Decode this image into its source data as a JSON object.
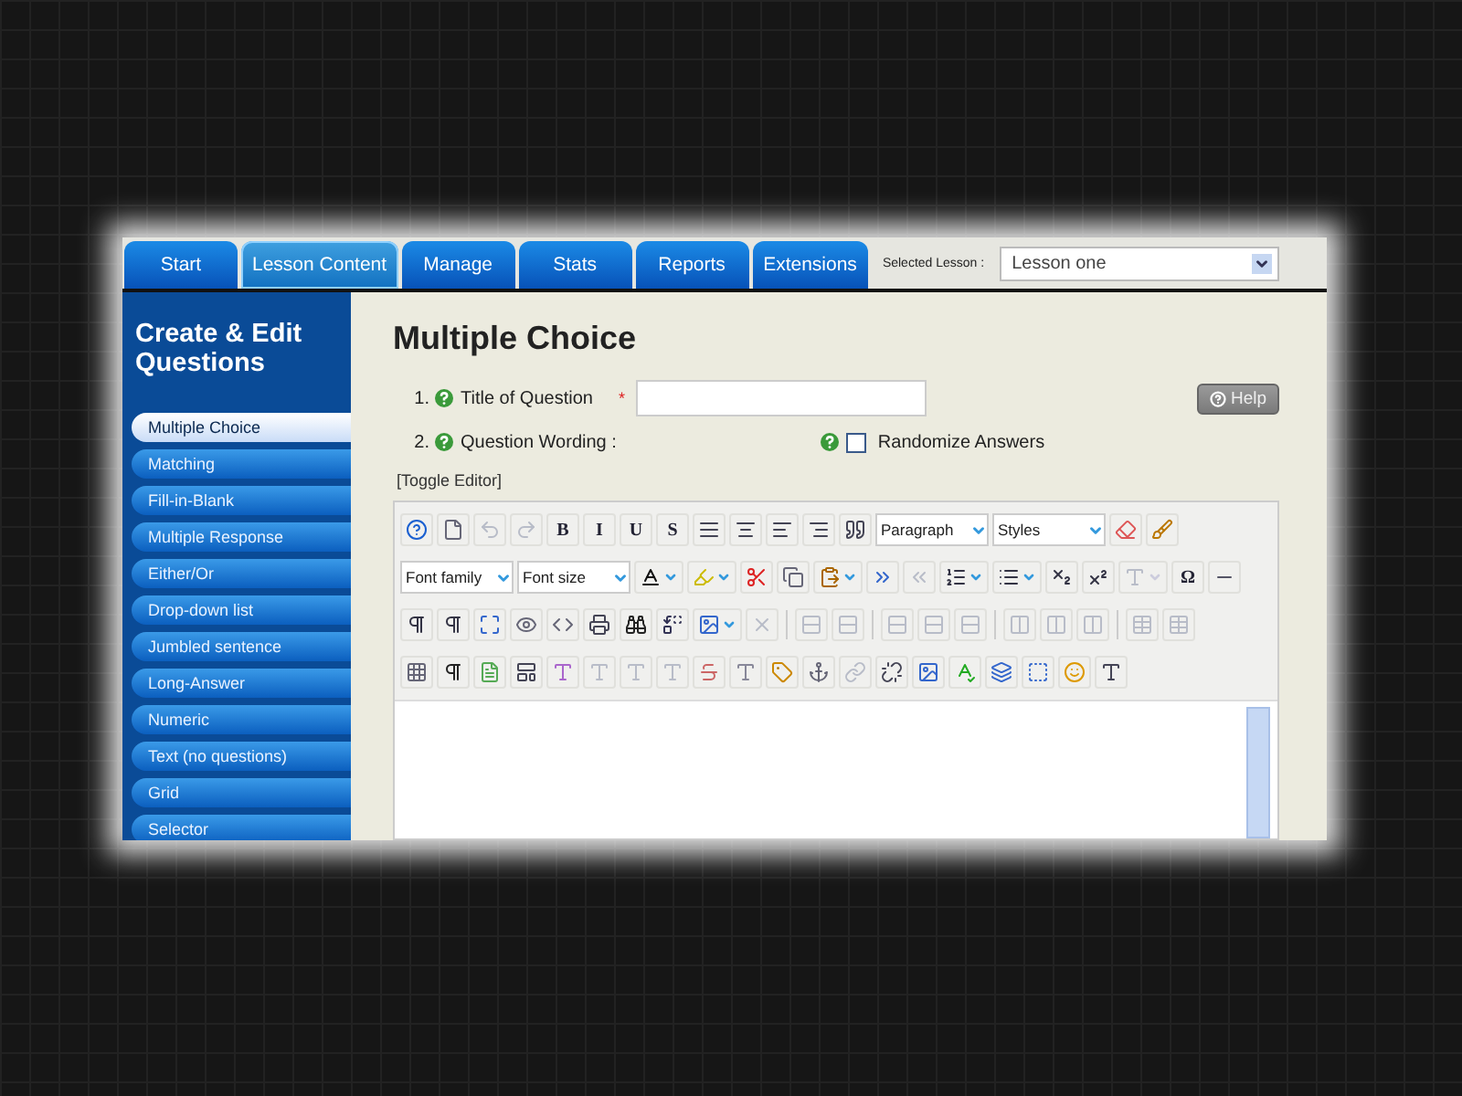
{
  "tabs": [
    {
      "label": "Start",
      "selected": false
    },
    {
      "label": "Lesson Content",
      "selected": true
    },
    {
      "label": "Manage",
      "selected": false
    },
    {
      "label": "Stats",
      "selected": false
    },
    {
      "label": "Reports",
      "selected": false
    },
    {
      "label": "Extensions",
      "selected": false
    }
  ],
  "lesson_selector": {
    "label": "Selected Lesson :",
    "value": "Lesson one"
  },
  "sidebar": {
    "title": "Create & Edit Questions",
    "items": [
      {
        "label": "Multiple Choice",
        "selected": true
      },
      {
        "label": "Matching",
        "selected": false
      },
      {
        "label": "Fill-in-Blank",
        "selected": false
      },
      {
        "label": "Multiple Response",
        "selected": false
      },
      {
        "label": "Either/Or",
        "selected": false
      },
      {
        "label": "Drop-down list",
        "selected": false
      },
      {
        "label": "Jumbled sentence",
        "selected": false
      },
      {
        "label": "Long-Answer",
        "selected": false
      },
      {
        "label": "Numeric",
        "selected": false
      },
      {
        "label": "Text (no questions)",
        "selected": false
      },
      {
        "label": "Grid",
        "selected": false
      },
      {
        "label": "Selector",
        "selected": false
      }
    ]
  },
  "page_title": "Multiple Choice",
  "form": {
    "title_row": {
      "number": "1.",
      "label": "Title of Question",
      "required_mark": "*"
    },
    "help_button": "Help",
    "wording_row": {
      "number": "2.",
      "label": "Question Wording :"
    },
    "randomize": {
      "label": "Randomize Answers",
      "checked": false
    },
    "toggle_editor": "[Toggle Editor]"
  },
  "editor": {
    "toolbar_rows": [
      [
        {
          "kind": "icon",
          "disabled": false
        },
        {
          "kind": "icon",
          "disabled": false
        },
        {
          "kind": "icon",
          "disabled": true
        },
        {
          "kind": "icon",
          "disabled": true
        },
        {
          "kind": "letter",
          "text": "B",
          "disabled": false
        },
        {
          "kind": "letter",
          "text": "I",
          "disabled": false
        },
        {
          "kind": "letter",
          "text": "U",
          "disabled": false
        },
        {
          "kind": "letter",
          "text": "S",
          "disabled": false
        },
        {
          "kind": "icon",
          "disabled": false
        },
        {
          "kind": "icon",
          "disabled": false
        },
        {
          "kind": "icon",
          "disabled": false
        },
        {
          "kind": "icon",
          "disabled": false
        },
        {
          "kind": "icon",
          "disabled": false
        },
        {
          "kind": "select",
          "text": "Paragraph"
        },
        {
          "kind": "select",
          "text": "Styles"
        },
        {
          "kind": "icon",
          "disabled": false
        },
        {
          "kind": "icon",
          "disabled": false
        }
      ],
      [
        {
          "kind": "select",
          "text": "Font family"
        },
        {
          "kind": "select",
          "text": "Font size"
        },
        {
          "kind": "split",
          "disabled": false
        },
        {
          "kind": "split",
          "disabled": false
        },
        {
          "kind": "icon",
          "disabled": false
        },
        {
          "kind": "icon",
          "disabled": false
        },
        {
          "kind": "split",
          "disabled": false
        },
        {
          "kind": "icon",
          "disabled": false
        },
        {
          "kind": "icon",
          "disabled": true
        },
        {
          "kind": "split",
          "disabled": false
        },
        {
          "kind": "split",
          "disabled": false
        },
        {
          "kind": "icon",
          "disabled": false
        },
        {
          "kind": "icon",
          "disabled": false
        },
        {
          "kind": "split",
          "disabled": true
        },
        {
          "kind": "letter",
          "text": "Ω",
          "disabled": false
        },
        {
          "kind": "icon",
          "disabled": false
        }
      ],
      [
        {
          "kind": "icon",
          "disabled": false
        },
        {
          "kind": "icon",
          "disabled": false
        },
        {
          "kind": "icon",
          "disabled": false
        },
        {
          "kind": "icon",
          "disabled": false
        },
        {
          "kind": "icon",
          "disabled": false
        },
        {
          "kind": "icon",
          "disabled": false
        },
        {
          "kind": "icon",
          "disabled": false
        },
        {
          "kind": "icon",
          "disabled": false
        },
        {
          "kind": "split",
          "disabled": false
        },
        {
          "kind": "icon",
          "disabled": true
        },
        {
          "kind": "separator"
        },
        {
          "kind": "icon",
          "disabled": true
        },
        {
          "kind": "icon",
          "disabled": true
        },
        {
          "kind": "separator"
        },
        {
          "kind": "icon",
          "disabled": true
        },
        {
          "kind": "icon",
          "disabled": true
        },
        {
          "kind": "icon",
          "disabled": true
        },
        {
          "kind": "separator"
        },
        {
          "kind": "icon",
          "disabled": true
        },
        {
          "kind": "icon",
          "disabled": true
        },
        {
          "kind": "icon",
          "disabled": true
        },
        {
          "kind": "separator"
        },
        {
          "kind": "icon",
          "disabled": true
        },
        {
          "kind": "icon",
          "disabled": true
        }
      ],
      [
        {
          "kind": "icon",
          "disabled": false
        },
        {
          "kind": "icon",
          "disabled": false
        },
        {
          "kind": "icon",
          "disabled": false
        },
        {
          "kind": "icon",
          "disabled": false
        },
        {
          "kind": "icon",
          "disabled": false
        },
        {
          "kind": "icon",
          "disabled": true
        },
        {
          "kind": "icon",
          "disabled": true
        },
        {
          "kind": "icon",
          "disabled": true
        },
        {
          "kind": "icon",
          "disabled": false
        },
        {
          "kind": "icon",
          "disabled": false
        },
        {
          "kind": "icon",
          "disabled": false
        },
        {
          "kind": "icon",
          "disabled": false
        },
        {
          "kind": "icon",
          "disabled": true
        },
        {
          "kind": "icon",
          "disabled": false
        },
        {
          "kind": "icon",
          "disabled": false
        },
        {
          "kind": "icon",
          "disabled": false
        },
        {
          "kind": "icon",
          "disabled": false
        },
        {
          "kind": "icon",
          "disabled": false
        },
        {
          "kind": "icon",
          "disabled": false
        },
        {
          "kind": "icon",
          "disabled": false
        }
      ]
    ]
  }
}
